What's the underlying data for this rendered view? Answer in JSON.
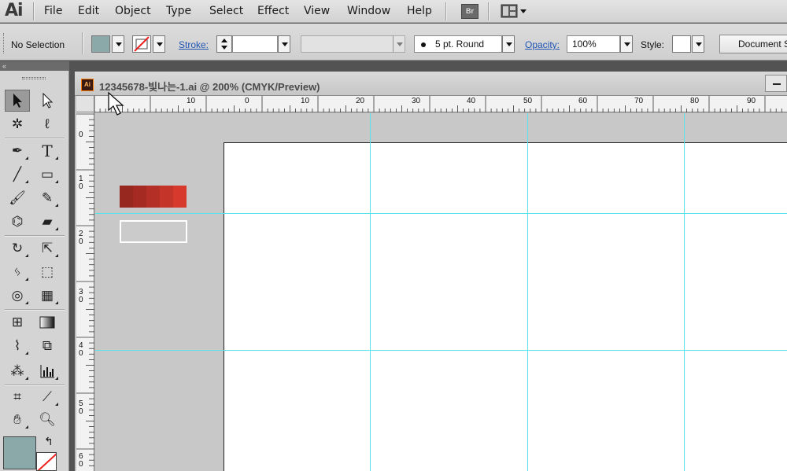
{
  "app": {
    "logo": "Ai"
  },
  "menu": [
    "File",
    "Edit",
    "Object",
    "Type",
    "Select",
    "Effect",
    "View",
    "Window",
    "Help"
  ],
  "bridge_button": "Br",
  "control_bar": {
    "selection_label": "No Selection",
    "stroke_label": "Stroke:",
    "brush_value": "5 pt. Round",
    "opacity_label": "Opacity:",
    "opacity_value": "100%",
    "style_label": "Style:",
    "document_button": "Document Setup"
  },
  "tools_panel": {
    "collapse_label": "«"
  },
  "document": {
    "title": "12345678-빛나는-1.ai @ 200% (CMYK/Preview)",
    "icon": "Ai"
  },
  "ruler": {
    "horizontal_labels": [
      "10",
      "0",
      "10",
      "20",
      "30",
      "40",
      "50",
      "60",
      "70",
      "80",
      "90"
    ],
    "vertical_labels": [
      "0",
      "1\n0",
      "2\n0",
      "3\n0",
      "4\n0",
      "5\n0",
      "6\n0"
    ]
  },
  "colors": {
    "fill": "#8ba9a9",
    "guides": "#57e3ea",
    "swatch_strip": [
      "#962820",
      "#a52b22",
      "#b42f25",
      "#c43428",
      "#d7392c"
    ]
  }
}
